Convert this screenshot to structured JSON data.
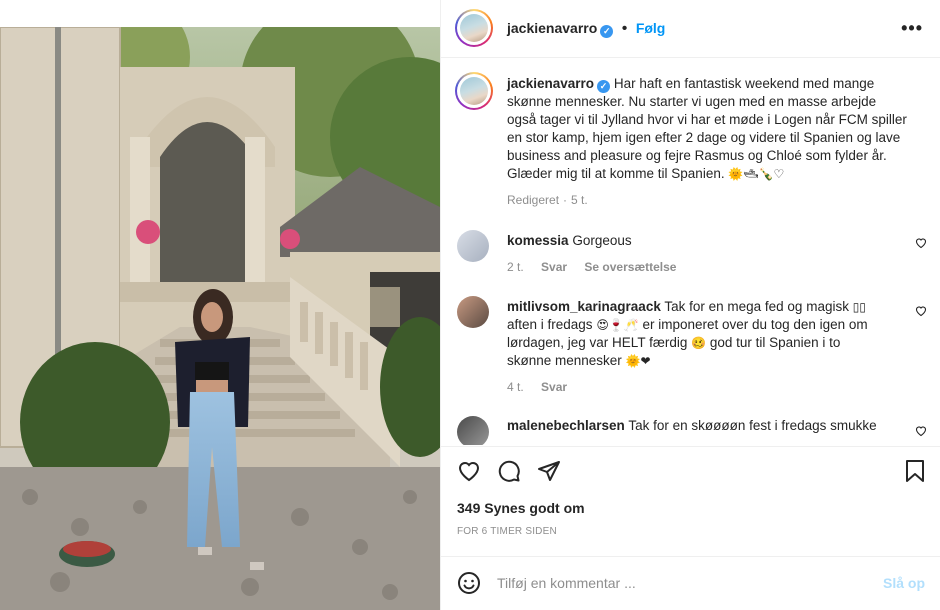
{
  "post": {
    "username": "jackienavarro",
    "follow_label": "Følg",
    "more_label": "•••",
    "caption": "Har haft en fantastisk weekend med mange skønne mennesker. Nu starter vi ugen med en masse arbejde også tager vi til Jylland hvor vi har et møde i Logen når FCM spiller en stor kamp, hjem igen efter 2 dage og videre til Spanien og lave business and pleasure og fejre Rasmus og Chloé som fylder år. Glæder mig til at komme til Spanien.",
    "caption_emoji": "🌞🛥🍾♡",
    "caption_edited": "Redigeret",
    "caption_age": "5 t.",
    "likes": "349 Synes godt om",
    "timestamp": "FOR 6 TIMER SIDEN"
  },
  "comments": [
    {
      "username": "komessia",
      "text": "Gorgeous",
      "age": "2 t.",
      "reply_label": "Svar",
      "translate_label": "Se oversættelse"
    },
    {
      "username": "mitlivsom_karinagraack",
      "text_1": "Tak for en mega fed og magisk",
      "text_1_emoji": "▯▯",
      "text_2": "aften i fredags",
      "text_2_emoji": "😍🍷🥂",
      "text_3": "er imponeret over du tog den igen om lørdagen, jeg var HELT færdig",
      "text_3_emoji": "🥴",
      "text_4": "god tur til Spanien i to skønne mennesker",
      "text_4_emoji": "🌞❤",
      "age": "4 t.",
      "reply_label": "Svar"
    },
    {
      "username": "malenebechlarsen",
      "text": "Tak for en skøøøøn fest i fredags smukke"
    }
  ],
  "composer": {
    "placeholder": "Tilføj en kommentar ...",
    "post_label": "Slå op"
  },
  "icons": [
    "verified-badge",
    "more-icon",
    "heart-icon",
    "comment-icon",
    "share-icon",
    "bookmark-icon",
    "emoji-icon"
  ],
  "colors": {
    "accent": "#0095f6",
    "verified": "#3897f0",
    "post_disabled": "#b2dffc",
    "muted": "#8e8e8e"
  }
}
